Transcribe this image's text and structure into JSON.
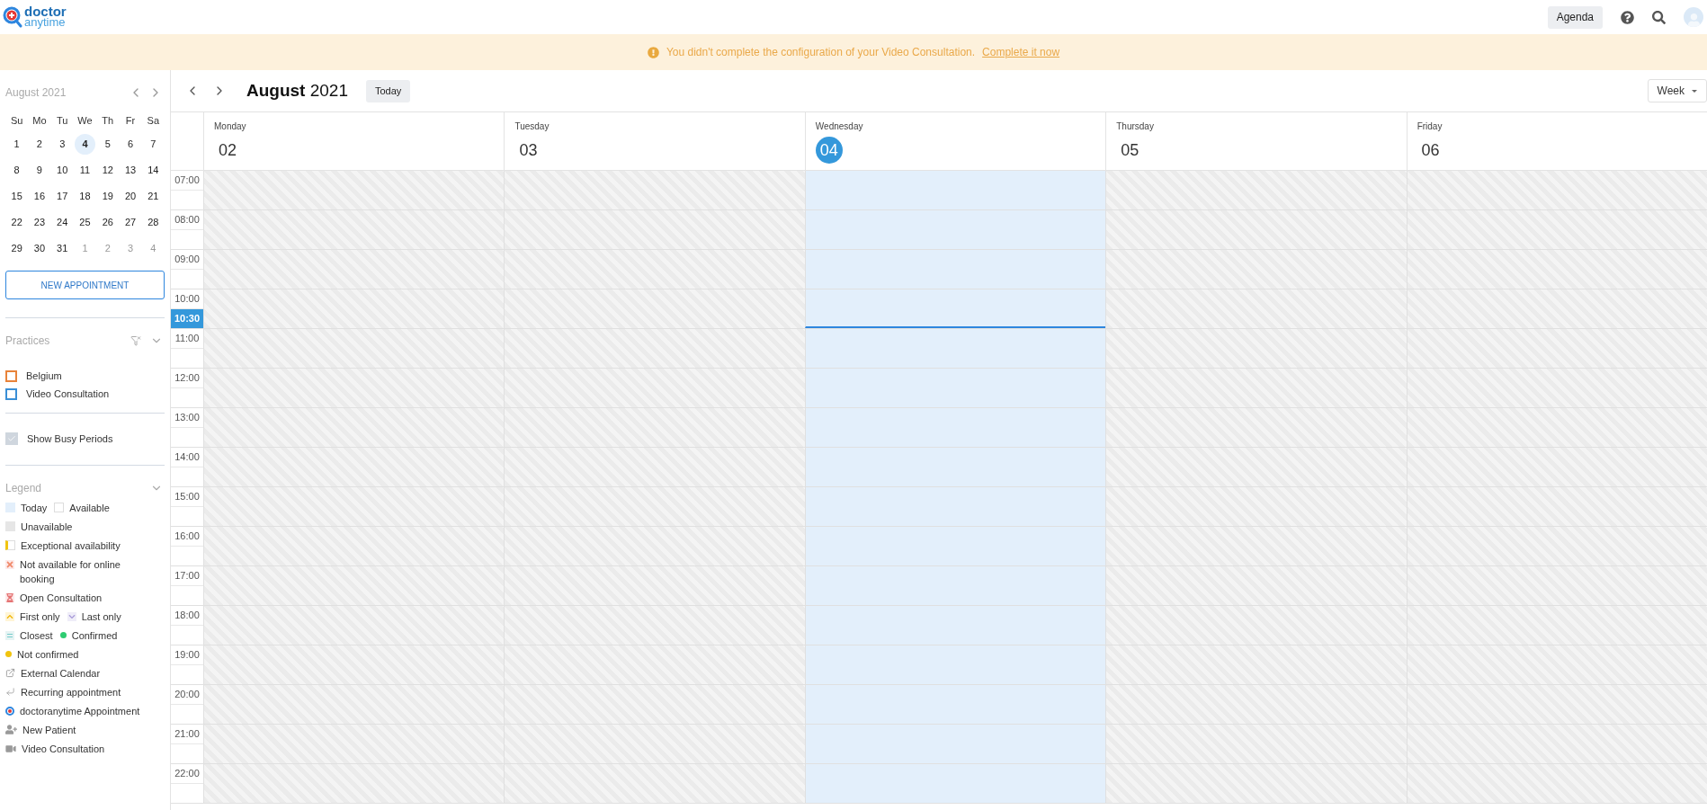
{
  "logo": {
    "top": "doctor",
    "bottom": "anytime"
  },
  "header": {
    "agenda_button": "Agenda"
  },
  "banner": {
    "message": "You didn't complete the configuration of your Video Consultation.",
    "link": "Complete it now"
  },
  "mini_calendar": {
    "title": "August 2021",
    "weekdays": [
      "Su",
      "Mo",
      "Tu",
      "We",
      "Th",
      "Fr",
      "Sa"
    ],
    "weeks": [
      [
        {
          "label": "1",
          "selected": false,
          "outside": false
        },
        {
          "label": "2",
          "selected": false,
          "outside": false
        },
        {
          "label": "3",
          "selected": false,
          "outside": false
        },
        {
          "label": "4",
          "selected": true,
          "outside": false
        },
        {
          "label": "5",
          "selected": false,
          "outside": false
        },
        {
          "label": "6",
          "selected": false,
          "outside": false
        },
        {
          "label": "7",
          "selected": false,
          "outside": false
        }
      ],
      [
        {
          "label": "8",
          "selected": false,
          "outside": false
        },
        {
          "label": "9",
          "selected": false,
          "outside": false
        },
        {
          "label": "10",
          "selected": false,
          "outside": false
        },
        {
          "label": "11",
          "selected": false,
          "outside": false
        },
        {
          "label": "12",
          "selected": false,
          "outside": false
        },
        {
          "label": "13",
          "selected": false,
          "outside": false
        },
        {
          "label": "14",
          "selected": false,
          "outside": false
        }
      ],
      [
        {
          "label": "15",
          "selected": false,
          "outside": false
        },
        {
          "label": "16",
          "selected": false,
          "outside": false
        },
        {
          "label": "17",
          "selected": false,
          "outside": false
        },
        {
          "label": "18",
          "selected": false,
          "outside": false
        },
        {
          "label": "19",
          "selected": false,
          "outside": false
        },
        {
          "label": "20",
          "selected": false,
          "outside": false
        },
        {
          "label": "21",
          "selected": false,
          "outside": false
        }
      ],
      [
        {
          "label": "22",
          "selected": false,
          "outside": false
        },
        {
          "label": "23",
          "selected": false,
          "outside": false
        },
        {
          "label": "24",
          "selected": false,
          "outside": false
        },
        {
          "label": "25",
          "selected": false,
          "outside": false
        },
        {
          "label": "26",
          "selected": false,
          "outside": false
        },
        {
          "label": "27",
          "selected": false,
          "outside": false
        },
        {
          "label": "28",
          "selected": false,
          "outside": false
        }
      ],
      [
        {
          "label": "29",
          "selected": false,
          "outside": false
        },
        {
          "label": "30",
          "selected": false,
          "outside": false
        },
        {
          "label": "31",
          "selected": false,
          "outside": false
        },
        {
          "label": "1",
          "selected": false,
          "outside": true
        },
        {
          "label": "2",
          "selected": false,
          "outside": true
        },
        {
          "label": "3",
          "selected": false,
          "outside": true
        },
        {
          "label": "4",
          "selected": false,
          "outside": true
        }
      ]
    ]
  },
  "new_appointment_button": "NEW APPOINTMENT",
  "practices": {
    "title": "Practices",
    "items": [
      {
        "label": "Belgium",
        "color": "#e8833a",
        "checked": false
      },
      {
        "label": "Video Consultation",
        "color": "#3a8fd6",
        "checked": false
      }
    ]
  },
  "busy_periods": {
    "label": "Show Busy Periods",
    "checked": true
  },
  "legend": {
    "title": "Legend",
    "rows": [
      [
        {
          "kind": "today",
          "label": "Today"
        },
        {
          "kind": "available",
          "label": "Available"
        }
      ],
      [
        {
          "kind": "unavailable",
          "label": "Unavailable"
        }
      ],
      [
        {
          "kind": "exceptional",
          "label": "Exceptional availability"
        }
      ],
      [
        {
          "kind": "not-online",
          "label": "Not available for online booking"
        }
      ],
      [
        {
          "kind": "open",
          "label": "Open Consultation"
        }
      ],
      [
        {
          "kind": "first",
          "label": "First only"
        },
        {
          "kind": "last",
          "label": "Last only"
        }
      ],
      [
        {
          "kind": "closest",
          "label": "Closest"
        },
        {
          "kind": "dot",
          "label": "Confirmed",
          "color": "#2ecc71"
        }
      ],
      [
        {
          "kind": "dot",
          "label": "Not confirmed",
          "color": "#f1c40f"
        }
      ],
      [
        {
          "kind": "external",
          "label": "External Calendar"
        }
      ],
      [
        {
          "kind": "recurring",
          "label": "Recurring appointment"
        }
      ],
      [
        {
          "kind": "da",
          "label": "doctoranytime Appointment"
        }
      ],
      [
        {
          "kind": "patient",
          "label": "New Patient"
        }
      ],
      [
        {
          "kind": "video",
          "label": "Video Consultation"
        }
      ]
    ]
  },
  "toolbar": {
    "month": "August",
    "year": "2021",
    "today_button": "Today",
    "view": "Week"
  },
  "days": [
    {
      "name": "Monday",
      "number": "02",
      "today": false
    },
    {
      "name": "Tuesday",
      "number": "03",
      "today": false
    },
    {
      "name": "Wednesday",
      "number": "04",
      "today": true
    },
    {
      "name": "Thursday",
      "number": "05",
      "today": false
    },
    {
      "name": "Friday",
      "number": "06",
      "today": false
    }
  ],
  "hours": [
    {
      "label": "07:00"
    },
    {
      "label": "08:00"
    },
    {
      "label": "09:00"
    },
    {
      "label": "10:00",
      "now": "10:30"
    },
    {
      "label": "11:00"
    },
    {
      "label": "12:00"
    },
    {
      "label": "13:00"
    },
    {
      "label": "14:00"
    },
    {
      "label": "15:00"
    },
    {
      "label": "16:00"
    },
    {
      "label": "17:00"
    },
    {
      "label": "18:00"
    },
    {
      "label": "19:00"
    },
    {
      "label": "20:00"
    },
    {
      "label": "21:00"
    },
    {
      "label": "22:00"
    }
  ]
}
